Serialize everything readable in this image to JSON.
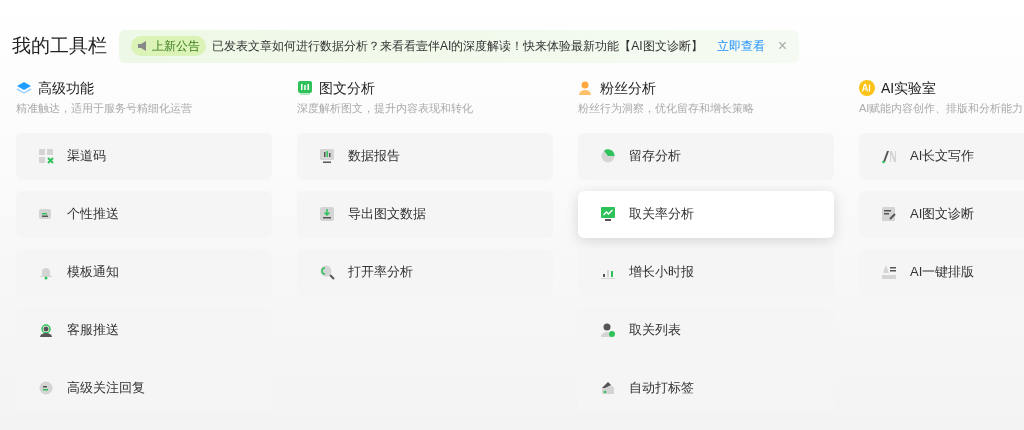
{
  "page_title": "我的工具栏",
  "announcement": {
    "badge": "上新公告",
    "text": "已发表文章如何进行数据分析？来看看壹伴AI的深度解读！快来体验最新功能【AI图文诊断】",
    "link": "立即查看",
    "close": "×"
  },
  "sections": [
    {
      "title": "高级功能",
      "subtitle": "精准触达，适用于服务号精细化运营",
      "items": [
        {
          "label": "渠道码",
          "selected": false
        },
        {
          "label": "个性推送",
          "selected": false
        },
        {
          "label": "模板通知",
          "selected": false
        },
        {
          "label": "客服推送",
          "selected": false
        },
        {
          "label": "高级关注回复",
          "selected": false
        }
      ]
    },
    {
      "title": "图文分析",
      "subtitle": "深度解析图文，提升内容表现和转化",
      "items": [
        {
          "label": "数据报告",
          "selected": false
        },
        {
          "label": "导出图文数据",
          "selected": false
        },
        {
          "label": "打开率分析",
          "selected": false
        }
      ]
    },
    {
      "title": "粉丝分析",
      "subtitle": "粉丝行为洞察，优化留存和增长策略",
      "items": [
        {
          "label": "留存分析",
          "selected": false
        },
        {
          "label": "取关率分析",
          "selected": true
        },
        {
          "label": "增长小时报",
          "selected": false
        },
        {
          "label": "取关列表",
          "selected": false
        },
        {
          "label": "自动打标签",
          "selected": false
        }
      ]
    },
    {
      "title": "AI实验室",
      "subtitle": "AI赋能内容创作、排版和分析能力",
      "items": [
        {
          "label": "AI长文写作",
          "selected": false
        },
        {
          "label": "AI图文诊断",
          "selected": false
        },
        {
          "label": "AI一键排版",
          "selected": false
        }
      ]
    }
  ]
}
